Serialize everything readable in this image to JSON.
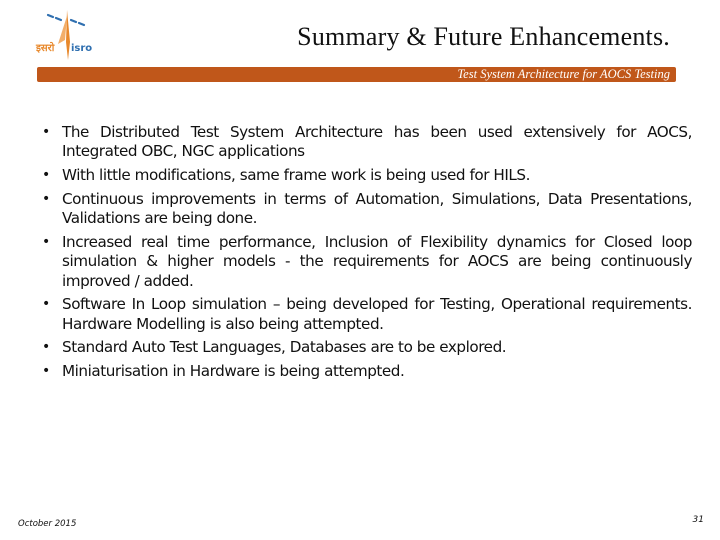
{
  "header": {
    "logo": {
      "name": "isro-logo",
      "hindi_text": "इसरो",
      "english_text": "isro",
      "colors": {
        "orange": "#e8882b",
        "blue": "#2f6fb0"
      }
    },
    "title": "Summary & Future Enhancements.",
    "banner_text": "Test System Architecture for AOCS Testing",
    "banner_color": "#c0571a"
  },
  "bullets": [
    "The Distributed Test System Architecture has been used extensively for AOCS, Integrated OBC, NGC applications",
    "With little modifications, same frame work is being used for HILS.",
    "Continuous improvements in terms of Automation, Simulations, Data Presentations, Validations are being done.",
    "Increased real time performance, Inclusion of Flexibility dynamics for Closed loop simulation & higher models  - the requirements for AOCS are being continuously improved / added.",
    "Software In Loop simulation – being developed for Testing, Operational requirements.  Hardware Modelling is also being attempted.",
    "Standard Auto Test Languages, Databases are to be explored.",
    "Miniaturisation in Hardware is being attempted."
  ],
  "bullet_glyph": "•",
  "footer": {
    "date": "October 2015",
    "page_number": "31"
  }
}
